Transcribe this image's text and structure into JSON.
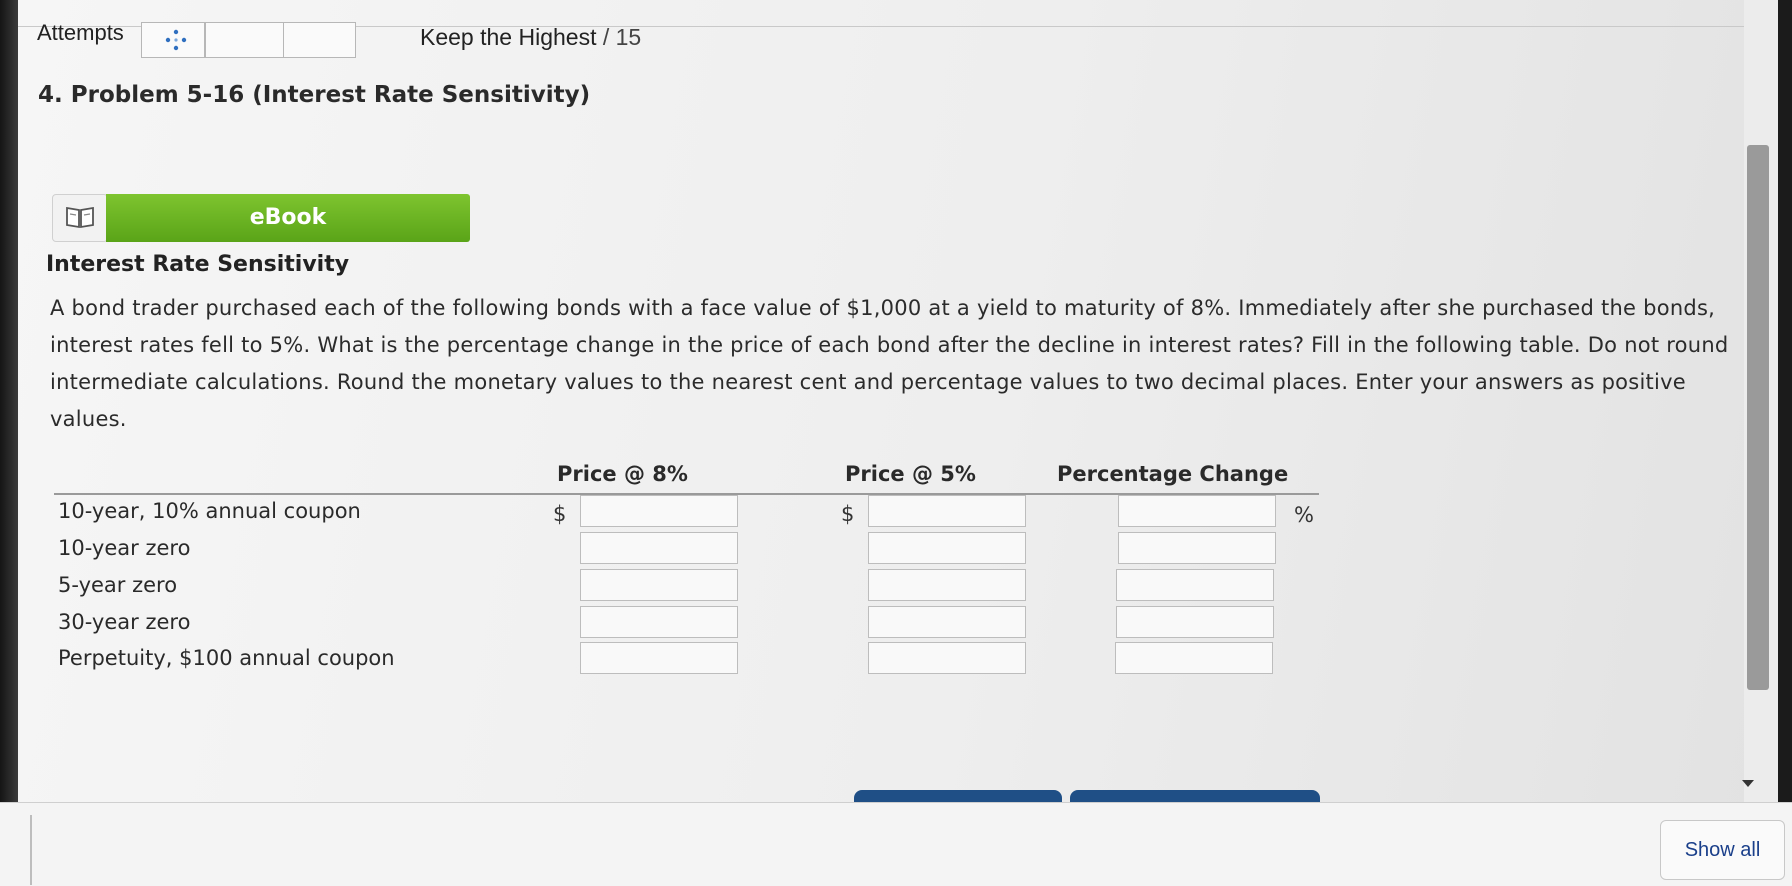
{
  "header": {
    "attempts_label": "Attempts",
    "keep_label": "Keep the Highest",
    "keep_score": "/ 15"
  },
  "problem": {
    "title": "4. Problem 5-16 (Interest Rate Sensitivity)"
  },
  "ebook": {
    "label": "eBook",
    "icon": "book-icon"
  },
  "section": {
    "heading": "Interest Rate Sensitivity",
    "paragraph": "A bond trader purchased each of the following bonds with a face value of $1,000 at a yield to maturity of 8%. Immediately after she purchased the bonds, interest rates fell to 5%. What is the percentage change in the price of each bond after the decline in interest rates? Fill in the following table. Do not round intermediate calculations. Round the monetary values to the nearest cent and percentage values to two decimal places. Enter your answers as positive values."
  },
  "table": {
    "columns": [
      "Price @ 8%",
      "Price @ 5%",
      "Percentage Change"
    ],
    "currency_symbol": "$",
    "percent_symbol": "%",
    "rows": [
      {
        "label": "10-year, 10% annual coupon",
        "price8": "",
        "price5": "",
        "change": ""
      },
      {
        "label": "10-year zero",
        "price8": "",
        "price5": "",
        "change": ""
      },
      {
        "label": "5-year zero",
        "price8": "",
        "price5": "",
        "change": ""
      },
      {
        "label": "30-year zero",
        "price8": "",
        "price5": "",
        "change": ""
      },
      {
        "label": "Perpetuity, $100 annual coupon",
        "price8": "",
        "price5": "",
        "change": ""
      }
    ]
  },
  "footer": {
    "show_all_label": "Show all"
  },
  "colors": {
    "ebook_green": "#6cb523",
    "button_blue": "#1f4f86",
    "link_blue": "#1a3f8a"
  }
}
